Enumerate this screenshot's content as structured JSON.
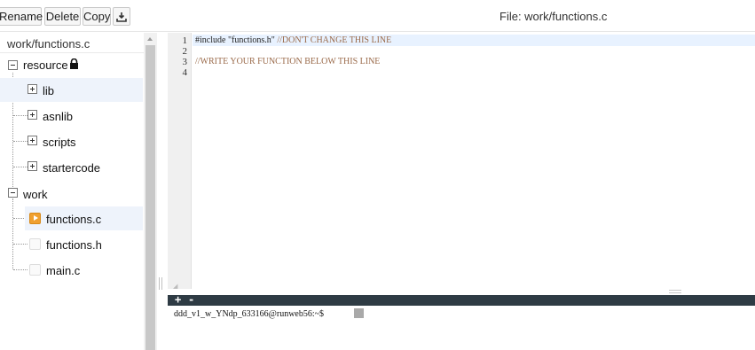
{
  "toolbar": {
    "rename_label": "Rename",
    "delete_label": "Delete",
    "copy_label": "Copy",
    "download_icon": "download-icon",
    "file_title": "File: work/functions.c"
  },
  "tree": {
    "root_label": "work/functions.c",
    "nodes": [
      {
        "label": "resource",
        "type": "folder",
        "expanded": true,
        "locked": true
      },
      {
        "label": "lib",
        "type": "folder",
        "expanded": false
      },
      {
        "label": "asnlib",
        "type": "folder",
        "expanded": false
      },
      {
        "label": "scripts",
        "type": "folder",
        "expanded": false
      },
      {
        "label": "startercode",
        "type": "folder",
        "expanded": false
      },
      {
        "label": "work",
        "type": "folder",
        "expanded": true
      },
      {
        "label": "functions.c",
        "type": "file",
        "active": true
      },
      {
        "label": "functions.h",
        "type": "file"
      },
      {
        "label": "main.c",
        "type": "file"
      }
    ]
  },
  "editor": {
    "line_numbers": [
      "1",
      "2",
      "3",
      "4"
    ],
    "lines": [
      {
        "kw": "#include ",
        "str": "\"functions.h\"",
        "comment": " //DON'T CHANGE THIS LINE"
      },
      {
        "kw": "",
        "str": "",
        "comment": ""
      },
      {
        "kw": "",
        "str": "",
        "comment": "//WRITE YOUR FUNCTION BELOW THIS LINE"
      },
      {
        "kw": "",
        "str": "",
        "comment": ""
      }
    ]
  },
  "terminal": {
    "add_label": "+",
    "remove_label": "-",
    "prompt": "ddd_v1_w_YNdp_633166@runweb56:~$"
  },
  "colors": {
    "active_file": "#f0a030",
    "terminal_bar": "#2e3b44",
    "selected_row": "#eef3fb",
    "comment": "#9a6a4a"
  }
}
